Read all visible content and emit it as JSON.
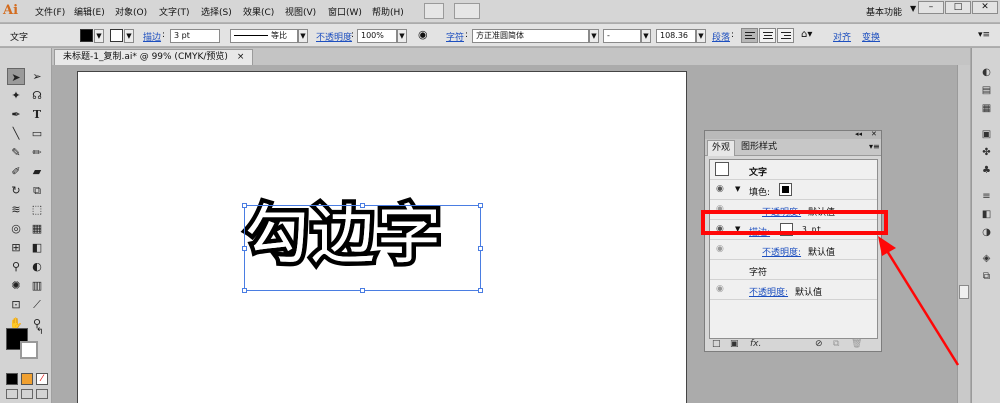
{
  "app": {
    "logo": "Ai"
  },
  "menu": [
    "文件(F)",
    "编辑(E)",
    "对象(O)",
    "文字(T)",
    "选择(S)",
    "效果(C)",
    "视图(V)",
    "窗口(W)",
    "帮助(H)"
  ],
  "workspace": {
    "label": "基本功能"
  },
  "window_controls": [
    "–",
    "□",
    "✕"
  ],
  "control_bar": {
    "context_label": "文字",
    "stroke_link": "描边",
    "stroke_weight": "3 pt",
    "stroke_profile": "等比",
    "opacity_link": "不透明度",
    "opacity_value": "100%",
    "font_link": "字符",
    "font_family": "方正准圆简体",
    "font_style": "-",
    "font_size": "108.36",
    "paragraph_link": "段落",
    "align_link": "对齐",
    "transform_link": "变换"
  },
  "document": {
    "tab_title": "未标题-1_复制.ai* @ 99% (CMYK/预览)"
  },
  "artwork": {
    "text": "勾边字"
  },
  "appearance_panel": {
    "tabs": [
      "外观",
      "图形样式"
    ],
    "rows": [
      {
        "label": "文字",
        "kind": "header"
      },
      {
        "label": "填色:",
        "kind": "fill"
      },
      {
        "label": "不透明度:",
        "value": "默认值",
        "kind": "sub"
      },
      {
        "label": "描边:",
        "value": "3 pt",
        "kind": "stroke"
      },
      {
        "label": "不透明度:",
        "value": "默认值",
        "kind": "sub"
      },
      {
        "label": "字符",
        "kind": "plain"
      },
      {
        "label": "不透明度:",
        "value": "默认值",
        "kind": "sub2"
      }
    ],
    "footer_fx": "fx."
  },
  "colors": {
    "highlight": "#ff0707",
    "link": "#1d4fbf",
    "logo": "#d36c1f",
    "selection": "#4a7de2"
  }
}
